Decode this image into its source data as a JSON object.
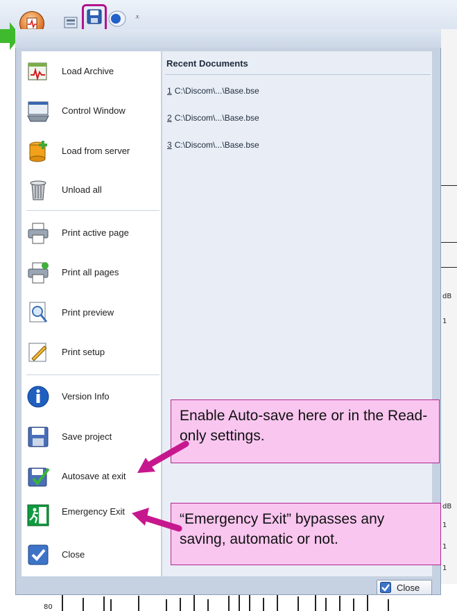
{
  "colors": {
    "callout_fill": "#f9c6f0",
    "callout_border": "#b0268f",
    "arrow": "#c7178e",
    "green_pointer": "#3fba2e"
  },
  "menu": {
    "items": [
      {
        "label": "Load Archive",
        "icon": "load-archive-icon"
      },
      {
        "label": "Control Window",
        "icon": "control-window-icon"
      },
      {
        "label": "Load from server",
        "icon": "load-from-server-icon"
      },
      {
        "label": "Unload all",
        "icon": "trash-icon"
      },
      {
        "label": "Print active page",
        "icon": "printer-icon"
      },
      {
        "label": "Print all pages",
        "icon": "printer-check-icon"
      },
      {
        "label": "Print preview",
        "icon": "magnifier-icon"
      },
      {
        "label": "Print setup",
        "icon": "pencil-page-icon"
      },
      {
        "label": "Version Info",
        "icon": "info-icon"
      },
      {
        "label": "Save project",
        "icon": "floppy-disk-icon"
      },
      {
        "label": "Autosave at exit",
        "icon": "floppy-check-icon"
      },
      {
        "label": "Emergency Exit",
        "icon": "emergency-exit-icon"
      },
      {
        "label": "Close",
        "icon": "checkbox-icon"
      }
    ],
    "recent_header": "Recent Documents",
    "recent": [
      {
        "num": "1",
        "path": "C:\\Discom\\...\\Base.bse"
      },
      {
        "num": "2",
        "path": "C:\\Discom\\...\\Base.bse"
      },
      {
        "num": "3",
        "path": "C:\\Discom\\...\\Base.bse"
      }
    ],
    "close_button": "Close"
  },
  "callouts": {
    "autosave": "Enable Auto-save here or in the Read-only settings.",
    "emergency": "“Emergency Exit” bypasses any saving, automatic or not."
  },
  "background": {
    "axis_value": "80",
    "side_labels": [
      "dB",
      "1",
      "dB",
      "1",
      "1",
      "1"
    ]
  }
}
